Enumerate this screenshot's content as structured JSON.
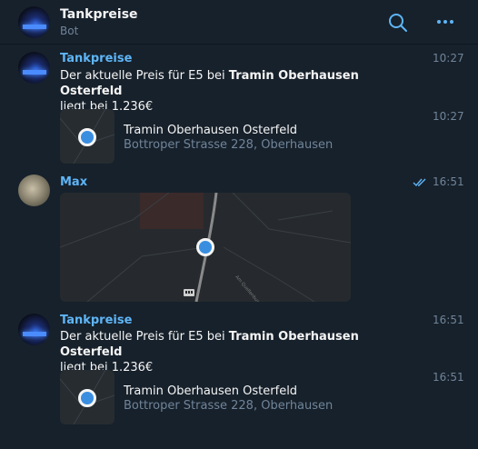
{
  "header": {
    "title": "Tankpreise",
    "subtitle": "Bot"
  },
  "messages": [
    {
      "sender": "Tankpreise",
      "time": "10:27",
      "text_prefix": "Der aktuelle Preis für E5 bei ",
      "text_bold": "Tramin Oberhausen Osterfeld",
      "text_suffix": "liegt bei 1.236€"
    },
    {
      "time": "10:27",
      "location_name": "Tramin Oberhausen Osterfeld",
      "location_address": "Bottroper Strasse 228, Oberhausen"
    },
    {
      "sender": "Max",
      "time": "16:51",
      "map_street_label": "Am Quellenbusch"
    },
    {
      "sender": "Tankpreise",
      "time": "16:51",
      "text_prefix": "Der aktuelle Preis für E5 bei ",
      "text_bold": "Tramin Oberhausen Osterfeld",
      "text_suffix": "liegt bei 1.236€"
    },
    {
      "time": "16:51",
      "location_name": "Tramin Oberhausen Osterfeld",
      "location_address": "Bottroper Strasse 228, Oberhausen"
    }
  ],
  "colors": {
    "background": "#17212b",
    "accent": "#5eb5f7",
    "muted": "#708499",
    "pin": "#3a8ee0"
  },
  "icons": {
    "search": "search-icon",
    "more": "more-icon",
    "read": "double-check-icon"
  }
}
